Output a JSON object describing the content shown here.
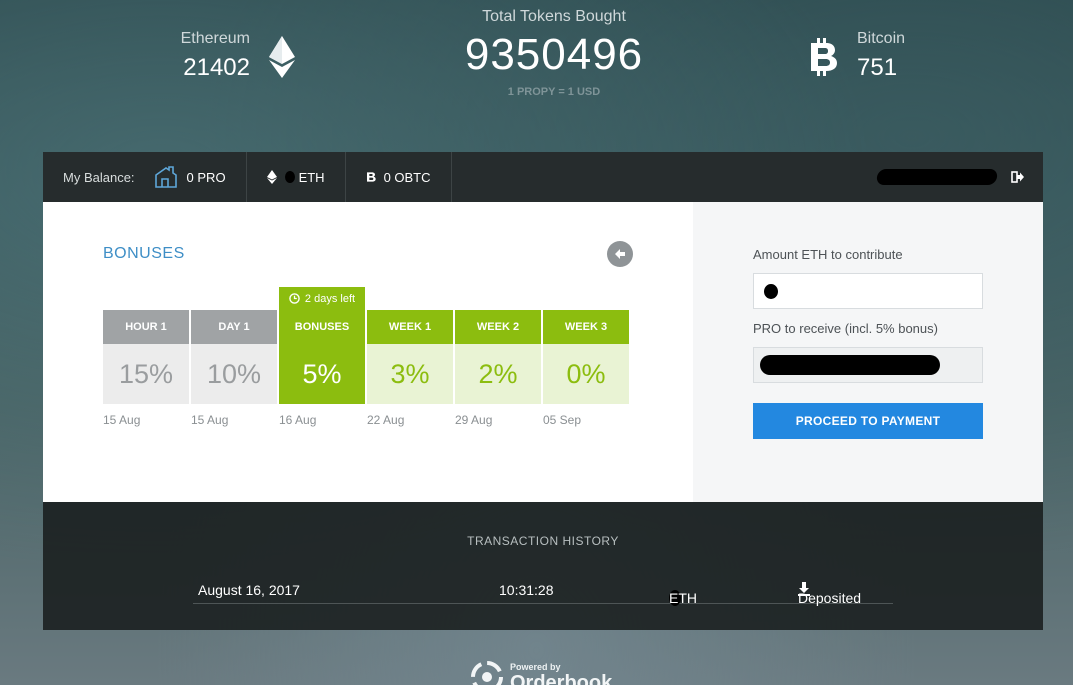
{
  "stats": {
    "ethereum": {
      "label": "Ethereum",
      "value": "21402"
    },
    "total": {
      "label": "Total Tokens Bought",
      "value": "9350496",
      "rate": "1 PROPY = 1 USD"
    },
    "bitcoin": {
      "label": "Bitcoin",
      "value": "751"
    }
  },
  "balance": {
    "label": "My Balance:",
    "pro": "0 PRO",
    "eth": "ETH",
    "btc": "0 OBTC"
  },
  "bonuses": {
    "title": "BONUSES",
    "days_left": "2 days left",
    "tiers": [
      {
        "head": "HOUR 1",
        "pct": "15%",
        "date": "15 Aug",
        "state": "past"
      },
      {
        "head": "DAY 1",
        "pct": "10%",
        "date": "15 Aug",
        "state": "past"
      },
      {
        "head": "BONUSES",
        "pct": "5%",
        "date": "16 Aug",
        "state": "current"
      },
      {
        "head": "WEEK 1",
        "pct": "3%",
        "date": "22 Aug",
        "state": "future"
      },
      {
        "head": "WEEK 2",
        "pct": "2%",
        "date": "29 Aug",
        "state": "future"
      },
      {
        "head": "WEEK 3",
        "pct": "0%",
        "date": "05 Sep",
        "state": "future"
      }
    ]
  },
  "contribute": {
    "amount_label": "Amount ETH to contribute",
    "receive_label": "PRO to receive (incl. 5% bonus)",
    "button": "PROCEED TO PAYMENT"
  },
  "transactions": {
    "title": "TRANSACTION HISTORY",
    "rows": [
      {
        "date": "August 16, 2017",
        "time": "10:31:28",
        "amount_unit": "ETH",
        "status": "Deposited"
      }
    ]
  },
  "footer": {
    "powered_by": "Powered by",
    "brand": "Orderbook"
  },
  "colors": {
    "green": "#8cbd0f",
    "blue": "#2388e0",
    "title_blue": "#3e8ec6"
  }
}
